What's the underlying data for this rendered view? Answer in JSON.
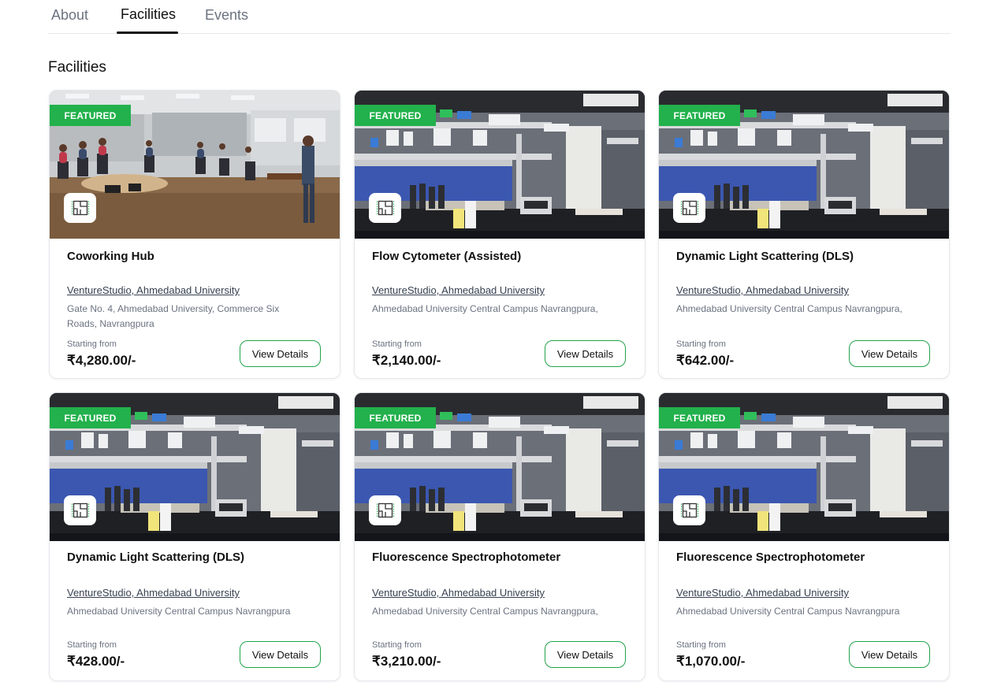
{
  "tabs": [
    {
      "label": "About"
    },
    {
      "label": "Facilities"
    },
    {
      "label": "Events"
    }
  ],
  "section_title": "Facilities",
  "featured_label": "FEATURED",
  "starting_from_label": "Starting from",
  "view_details_label": "View Details",
  "colors": {
    "accent": "#22b14c",
    "button_border": "#22a34a"
  },
  "icons": {
    "floor_plan": "floor-plan-icon"
  },
  "cards": [
    {
      "title": "Coworking Hub",
      "org": "VentureStudio, Ahmedabad University",
      "address": "Gate No. 4, Ahmedabad University, Commerce Six Roads, Navrangpura",
      "price": "₹4,280.00/-",
      "image": "classroom"
    },
    {
      "title": "Flow Cytometer (Assisted)",
      "org": "VentureStudio, Ahmedabad University",
      "address": "Ahmedabad University Central Campus Navrangpura,",
      "price": "₹2,140.00/-",
      "image": "lab"
    },
    {
      "title": "Dynamic Light Scattering (DLS)",
      "org": "VentureStudio, Ahmedabad University",
      "address": "Ahmedabad University Central Campus Navrangpura,",
      "price": "₹642.00/-",
      "image": "lab"
    },
    {
      "title": "Dynamic Light Scattering (DLS)",
      "org": "VentureStudio, Ahmedabad University",
      "address": "Ahmedabad University Central Campus Navrangpura",
      "price": "₹428.00/-",
      "image": "lab"
    },
    {
      "title": "Fluorescence Spectrophotometer",
      "org": "VentureStudio, Ahmedabad University",
      "address": "Ahmedabad University Central Campus Navrangpura,",
      "price": "₹3,210.00/-",
      "image": "lab"
    },
    {
      "title": "Fluorescence Spectrophotometer",
      "org": "VentureStudio, Ahmedabad University",
      "address": "Ahmedabad University Central Campus Navrangpura",
      "price": "₹1,070.00/-",
      "image": "lab"
    }
  ]
}
